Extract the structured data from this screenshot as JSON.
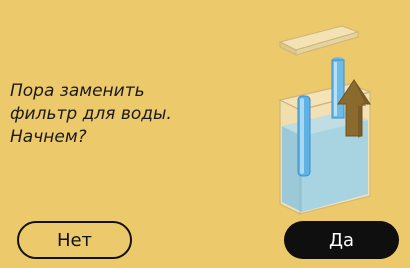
{
  "prompt": {
    "line1": "Пора заменить",
    "line2": "фильтр для воды.",
    "line3": "Начнем?"
  },
  "buttons": {
    "no_label": "Нет",
    "yes_label": "Да"
  },
  "illustration": {
    "icon": "water-filter-replace-icon"
  },
  "colors": {
    "background": "#ecc96b",
    "button_dark": "#0f0f0f",
    "filter_blue": "#7cc6ef",
    "arrow_brown": "#8b6a2e"
  }
}
